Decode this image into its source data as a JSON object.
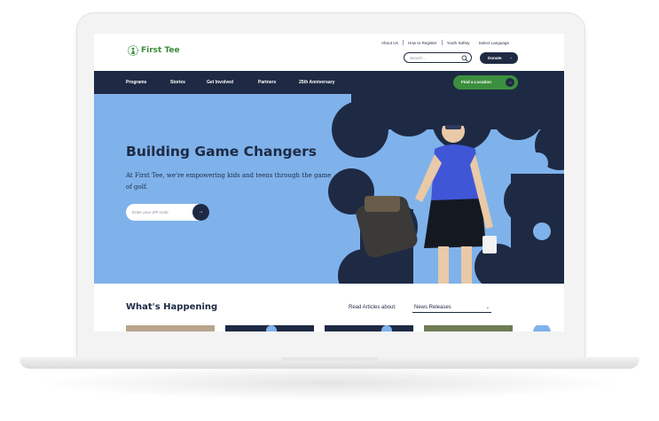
{
  "header": {
    "logo_text": "First Tee",
    "utility_links": [
      "About Us",
      "How to Register",
      "Youth Safety"
    ],
    "select_language": "Select Language",
    "search_placeholder": "Search ...",
    "donate_label": "Donate"
  },
  "nav": {
    "items": [
      "Programs",
      "Stories",
      "Get Involved",
      "Partners",
      "25th Anniversary"
    ],
    "find_location_label": "Find a Location"
  },
  "hero": {
    "title": "Building Game Changers",
    "subtitle": "At First Tee, we're empowering kids and teens through the game of golf.",
    "zip_placeholder": "Enter your ZIP code"
  },
  "section": {
    "title": "What's Happening",
    "read_articles_label": "Read Articles about:",
    "filter_selected": "News Releases"
  },
  "colors": {
    "navy": "#1e2a44",
    "hero_blue": "#7fb2eb",
    "brand_green": "#3c8f3e"
  },
  "icons": {
    "search": "search-icon",
    "arrow": "arrow-right-icon",
    "chevron": "chevron-down-icon"
  }
}
